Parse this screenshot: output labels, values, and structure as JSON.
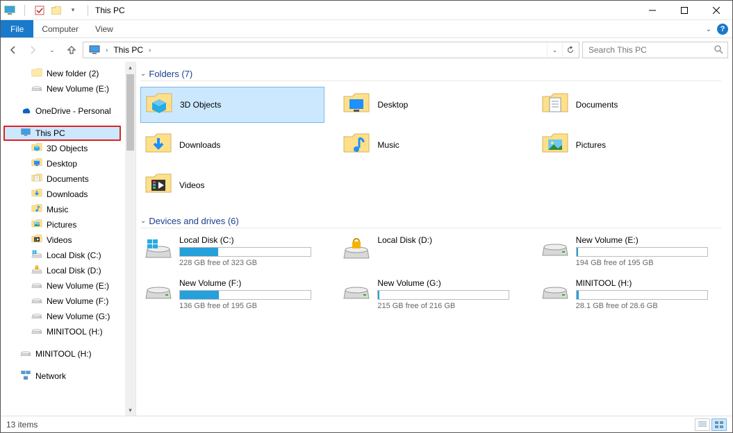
{
  "title": "This PC",
  "menubar": {
    "file": "File",
    "computer": "Computer",
    "view": "View"
  },
  "address": {
    "location": "This PC"
  },
  "search": {
    "placeholder": "Search This PC"
  },
  "tree": {
    "quick": [
      {
        "label": "New folder (2)",
        "icon": "folder"
      },
      {
        "label": "New Volume (E:)",
        "icon": "drive"
      }
    ],
    "onedrive": "OneDrive - Personal",
    "thispc": "This PC",
    "thispc_children": [
      {
        "label": "3D Objects",
        "icon": "3d"
      },
      {
        "label": "Desktop",
        "icon": "desktop"
      },
      {
        "label": "Documents",
        "icon": "documents"
      },
      {
        "label": "Downloads",
        "icon": "downloads"
      },
      {
        "label": "Music",
        "icon": "music"
      },
      {
        "label": "Pictures",
        "icon": "pictures"
      },
      {
        "label": "Videos",
        "icon": "videos"
      },
      {
        "label": "Local Disk (C:)",
        "icon": "osdrive"
      },
      {
        "label": "Local Disk (D:)",
        "icon": "lockdrive"
      },
      {
        "label": "New Volume (E:)",
        "icon": "drive"
      },
      {
        "label": "New Volume (F:)",
        "icon": "drive"
      },
      {
        "label": "New Volume (G:)",
        "icon": "drive"
      },
      {
        "label": "MINITOOL (H:)",
        "icon": "drive"
      }
    ],
    "extra": [
      {
        "label": "MINITOOL (H:)",
        "icon": "drive"
      }
    ],
    "network": "Network"
  },
  "groups": {
    "folders_hdr": "Folders (7)",
    "drives_hdr": "Devices and drives (6)"
  },
  "folders": [
    {
      "label": "3D Objects",
      "icon": "3d",
      "selected": true
    },
    {
      "label": "Desktop",
      "icon": "desktop"
    },
    {
      "label": "Documents",
      "icon": "documents"
    },
    {
      "label": "Downloads",
      "icon": "downloads"
    },
    {
      "label": "Music",
      "icon": "music"
    },
    {
      "label": "Pictures",
      "icon": "pictures"
    },
    {
      "label": "Videos",
      "icon": "videos"
    }
  ],
  "drives": [
    {
      "name": "Local Disk (C:)",
      "free": "228 GB free of 323 GB",
      "used_pct": 29,
      "icon": "osdrive"
    },
    {
      "name": "Local Disk (D:)",
      "free": "",
      "used_pct": 0,
      "icon": "lockdrive",
      "nobar": true
    },
    {
      "name": "New Volume (E:)",
      "free": "194 GB free of 195 GB",
      "used_pct": 1,
      "icon": "drive"
    },
    {
      "name": "New Volume (F:)",
      "free": "136 GB free of 195 GB",
      "used_pct": 30,
      "icon": "drive"
    },
    {
      "name": "New Volume (G:)",
      "free": "215 GB free of 216 GB",
      "used_pct": 1,
      "icon": "drive"
    },
    {
      "name": "MINITOOL (H:)",
      "free": "28.1 GB free of 28.6 GB",
      "used_pct": 2,
      "icon": "drive"
    }
  ],
  "status": {
    "items": "13 items"
  }
}
